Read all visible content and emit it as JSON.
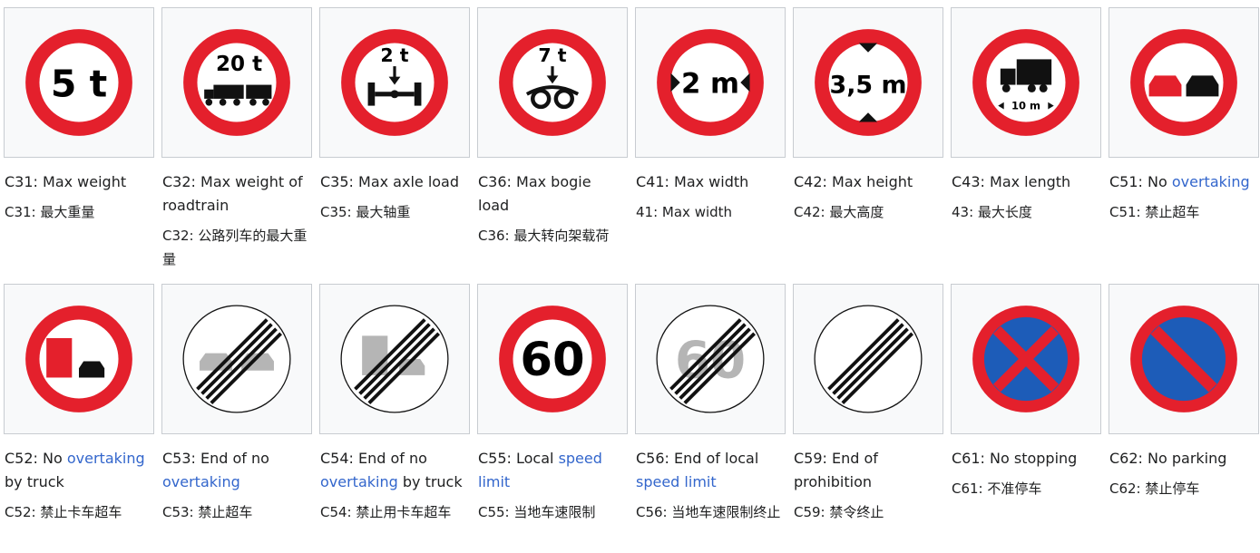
{
  "signs": [
    {
      "id": "c31",
      "en_before": "C31: Max weight",
      "en_link": "",
      "en_after": "",
      "zh": "C31: 最大重量",
      "glyph": "5 t"
    },
    {
      "id": "c32",
      "en_before": "C32: Max weight of roadtrain",
      "en_link": "",
      "en_after": "",
      "zh": "C32: 公路列车的最大重量",
      "glyph": "20 t"
    },
    {
      "id": "c35",
      "en_before": "C35: Max axle load",
      "en_link": "",
      "en_after": "",
      "zh": "C35: 最大轴重",
      "glyph": "2 t"
    },
    {
      "id": "c36",
      "en_before": "C36: Max bogie load",
      "en_link": "",
      "en_after": "",
      "zh": "C36: 最大转向架载荷",
      "glyph": "7 t"
    },
    {
      "id": "c41",
      "en_before": "C41: Max width",
      "en_link": "",
      "en_after": "",
      "zh": "41: Max width",
      "glyph": "2 m"
    },
    {
      "id": "c42",
      "en_before": "C42: Max height",
      "en_link": "",
      "en_after": "",
      "zh": "C42: 最大高度",
      "glyph": "3,5 m"
    },
    {
      "id": "c43",
      "en_before": "C43: Max length",
      "en_link": "",
      "en_after": "",
      "zh": "43: 最大长度",
      "glyph": "10 m"
    },
    {
      "id": "c51",
      "en_before": "C51: No ",
      "en_link": "overtaking",
      "en_after": "",
      "zh": "C51: 禁止超车",
      "glyph": ""
    },
    {
      "id": "c52",
      "en_before": "C52: No ",
      "en_link": "overtaking",
      "en_after": " by truck",
      "zh": "C52: 禁止卡车超车",
      "glyph": ""
    },
    {
      "id": "c53",
      "en_before": "C53: End of no ",
      "en_link": "overtaking",
      "en_after": "",
      "zh": "C53: 禁止超车",
      "glyph": ""
    },
    {
      "id": "c54",
      "en_before": "C54: End of no ",
      "en_link": "overtaking",
      "en_after": " by truck",
      "zh": "C54: 禁止用卡车超车",
      "glyph": ""
    },
    {
      "id": "c55",
      "en_before": "C55: Local ",
      "en_link": "speed limit",
      "en_after": "",
      "zh": "C55: 当地车速限制",
      "glyph": "60"
    },
    {
      "id": "c56",
      "en_before": "C56: End of local ",
      "en_link": "speed limit",
      "en_after": "",
      "zh": "C56: 当地车速限制终止",
      "glyph": "60"
    },
    {
      "id": "c59",
      "en_before": "C59: End of prohibition",
      "en_link": "",
      "en_after": "",
      "zh": "C59: 禁令终止",
      "glyph": ""
    },
    {
      "id": "c61",
      "en_before": "C61: No stopping",
      "en_link": "",
      "en_after": "",
      "zh": "C61: 不准停车",
      "glyph": ""
    },
    {
      "id": "c62",
      "en_before": "C62: No parking",
      "en_link": "",
      "en_after": "",
      "zh": "C62: 禁止停车",
      "glyph": ""
    }
  ],
  "colors": {
    "red": "#e4202c",
    "blue": "#1d5cb8",
    "black": "#111111",
    "grey": "#b5b5b5",
    "link": "#3366cc"
  }
}
